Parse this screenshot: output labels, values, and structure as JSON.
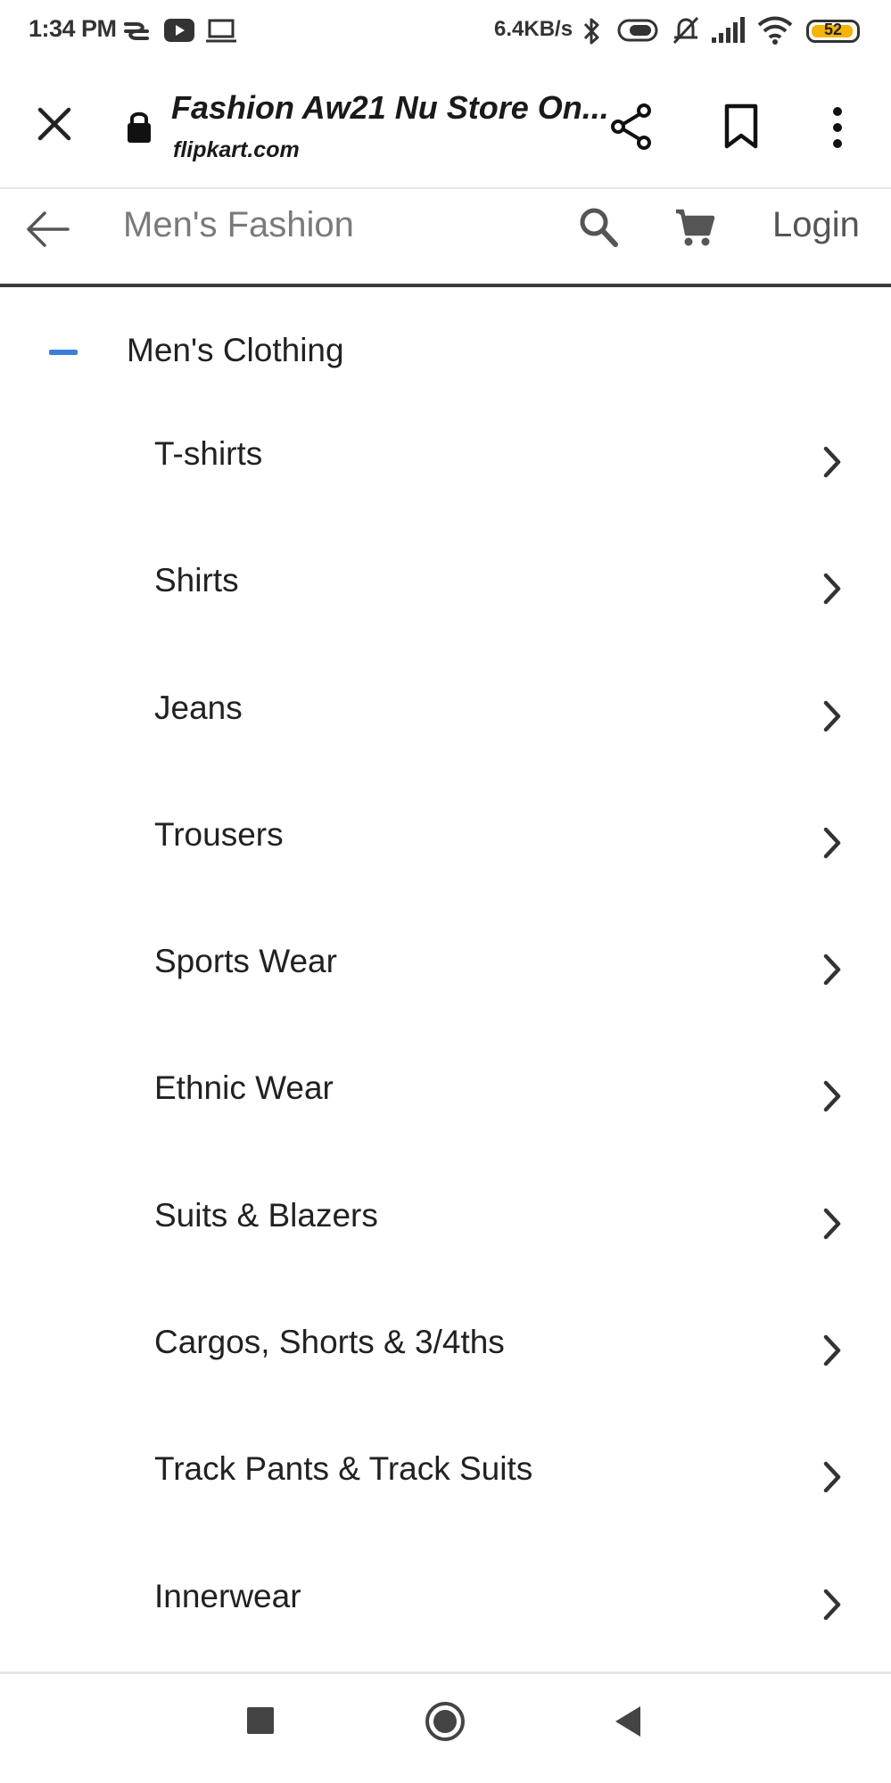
{
  "status_bar": {
    "time": "1:34 PM",
    "net_speed": "6.4KB/s",
    "battery_level": "52",
    "icons": [
      "sync-icon",
      "youtube-icon",
      "laptop-icon",
      "bluetooth-icon",
      "toggle-icon",
      "mute-icon",
      "signal-icon",
      "wifi-icon",
      "battery-icon"
    ]
  },
  "browser_bar": {
    "title": "Fashion Aw21 Nu Store On...",
    "domain": "flipkart.com"
  },
  "site_header": {
    "search_placeholder": "Men's Fashion",
    "login_label": "Login"
  },
  "menu": {
    "section_label": "Men's Clothing",
    "accent_color": "#3b7ddd",
    "items": [
      {
        "label": "T-shirts"
      },
      {
        "label": "Shirts"
      },
      {
        "label": "Jeans"
      },
      {
        "label": "Trousers"
      },
      {
        "label": "Sports Wear"
      },
      {
        "label": "Ethnic Wear"
      },
      {
        "label": "Suits & Blazers"
      },
      {
        "label": "Cargos, Shorts & 3/4ths"
      },
      {
        "label": "Track Pants & Track Suits"
      },
      {
        "label": "Innerwear"
      }
    ]
  },
  "nav_bar": {
    "buttons": [
      "recents-icon",
      "home-icon",
      "back-icon"
    ]
  }
}
